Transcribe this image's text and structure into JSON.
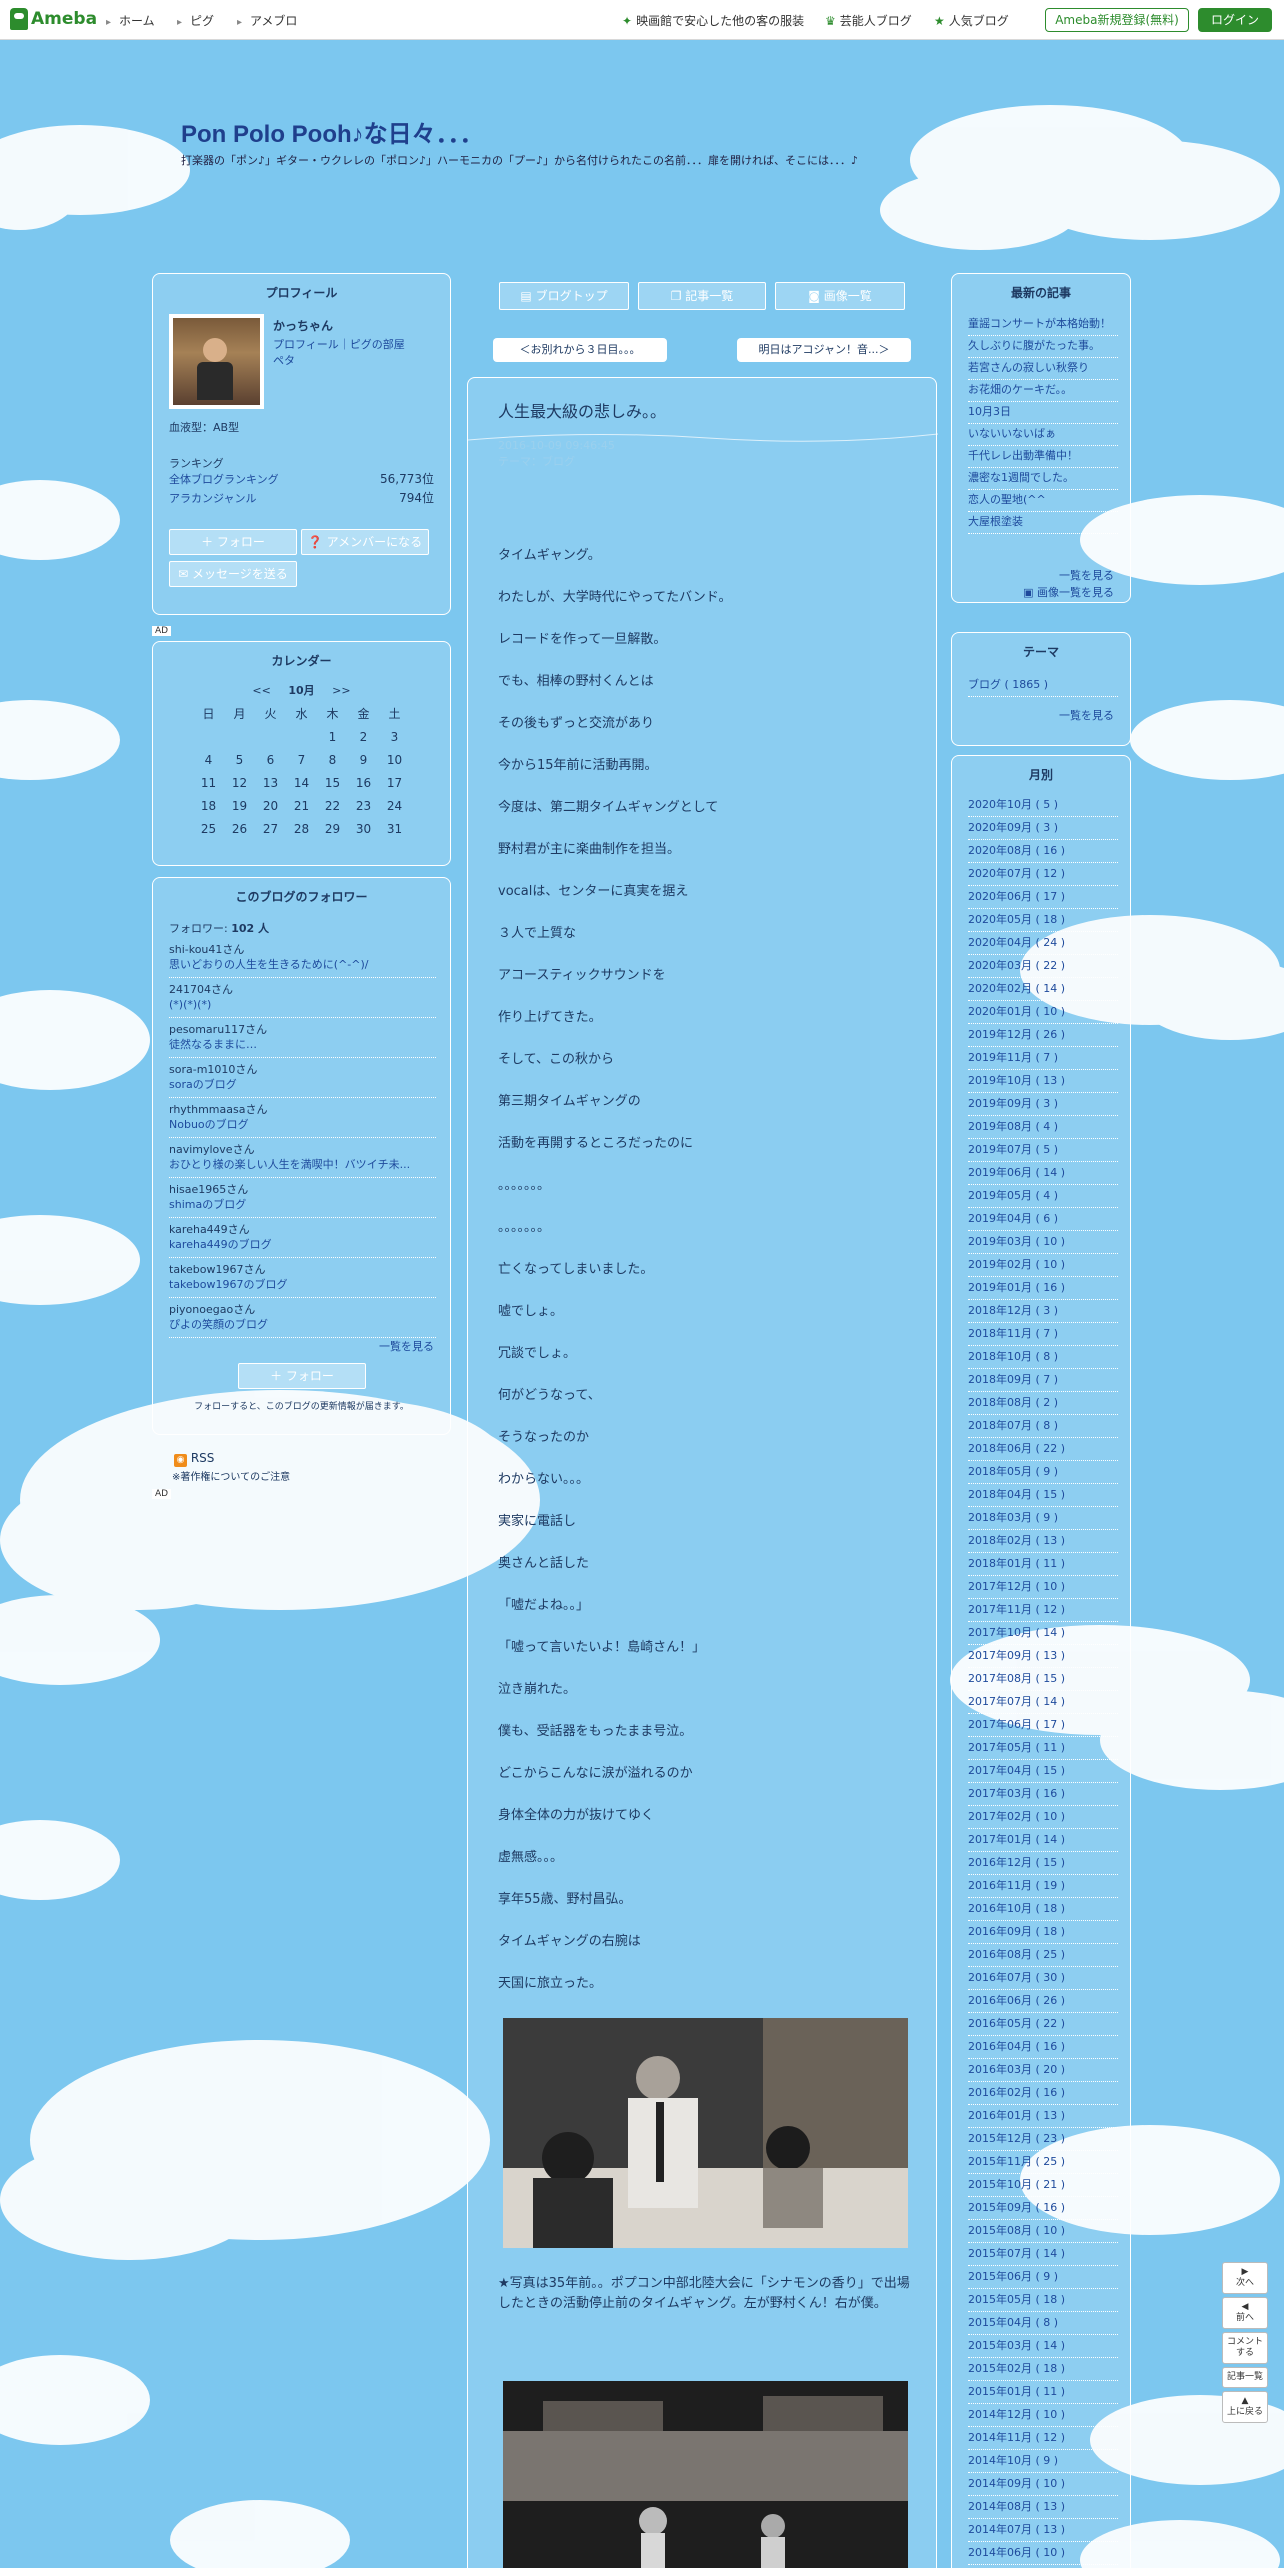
{
  "topbar": {
    "logo": "Ameba",
    "nav": [
      "ホーム",
      "ピグ",
      "アメブロ"
    ],
    "links": [
      "映画館で安心した他の客の服装",
      "芸能人ブログ",
      "人気ブログ"
    ],
    "register": "Ameba新規登録(無料)",
    "login": "ログイン"
  },
  "blog": {
    "title": "Pon Polo Pooh♪な日々．．．",
    "description": "打楽器の「ポン♪」ギター・ウクレレの「ポロン♪」ハーモニカの「プー♪」から名付けられたこの名前．．．扉を開ければ、そこには．．．♪"
  },
  "profile": {
    "heading": "プロフィール",
    "name": "かっちゃん",
    "links": "プロフィール｜ピグの部屋",
    "pet": "ペタ",
    "blood": "血液型：AB型",
    "ranking_heading": "ランキング",
    "rank1_label": "全体ブログランキング",
    "rank1_value": "56,773位",
    "rank2_label": "アラカンジャンル",
    "rank2_value": "794位",
    "follow": "フォロー",
    "member": "アメンバーになる",
    "message": "メッセージを送る"
  },
  "ad": "AD",
  "calendar": {
    "heading": "カレンダー",
    "prev": "<<",
    "month": "10月",
    "next": ">>",
    "weekdays": [
      "日",
      "月",
      "火",
      "水",
      "木",
      "金",
      "土"
    ],
    "weeks": [
      [
        "",
        "",
        "",
        "",
        "1",
        "2",
        "3"
      ],
      [
        "4",
        "5",
        "6",
        "7",
        "8",
        "9",
        "10"
      ],
      [
        "11",
        "12",
        "13",
        "14",
        "15",
        "16",
        "17"
      ],
      [
        "18",
        "19",
        "20",
        "21",
        "22",
        "23",
        "24"
      ],
      [
        "25",
        "26",
        "27",
        "28",
        "29",
        "30",
        "31"
      ]
    ]
  },
  "followers": {
    "heading": "このブログのフォロワー",
    "count_label": "フォロワー: ",
    "count": "102 人",
    "items": [
      [
        "shi-kou41さん",
        "思いどおりの人生を生きるために(^-^)/"
      ],
      [
        "241704さん",
        "(*)(*)(*)"
      ],
      [
        "pesomaru117さん",
        "徒然なるままに…"
      ],
      [
        "sora-m1010さん",
        "soraのブログ"
      ],
      [
        "rhythmmaasaさん",
        "Nobuoのブログ"
      ],
      [
        "navimyloveさん",
        "おひとり様の楽しい人生を満喫中！バツイチ未..."
      ],
      [
        "hisae1965さん",
        "shimaのブログ"
      ],
      [
        "kareha449さん",
        "kareha449のブログ"
      ],
      [
        "takebow1967さん",
        "takebow1967のブログ"
      ],
      [
        "piyonoegaoさん",
        "ぴよの笑顔のブログ"
      ]
    ],
    "more": "一覧を見る",
    "follow": "フォロー",
    "note": "フォローすると、このブログの更新情報が届きます。"
  },
  "rss": {
    "label": "RSS",
    "note": "※著作権についてのご注意"
  },
  "tabs": [
    "ブログトップ",
    "記事一覧",
    "画像一覧"
  ],
  "prev_post": "＜お別れから３日目。。。",
  "next_post": "明日はアコジャン！音...＞",
  "article": {
    "title": "人生最大級の悲しみ。。",
    "date": "2016-10-09 09:46:45",
    "theme": "テーマ：ブログ",
    "lines": [
      "タイムギャング。",
      "わたしが、大学時代にやってたバンド。",
      "レコードを作って一旦解散。",
      "でも、相棒の野村くんとは",
      "その後もずっと交流があり",
      "今から15年前に活動再開。",
      "今度は、第二期タイムギャングとして",
      "野村君が主に楽曲制作を担当。",
      "vocalは、センターに真実を据え",
      "３人で上質な",
      "アコースティックサウンドを",
      "作り上げてきた。",
      "そして、この秋から",
      "第三期タイムギャングの",
      "活動を再開するところだったのに",
      "。。。。。。。",
      "。。。。。。。",
      "亡くなってしまいました。",
      "嘘でしょ。",
      "冗談でしょ。",
      "何がどうなって、",
      "そうなったのか",
      "わからない。。。",
      "実家に電話し",
      "奥さんと話した",
      "「嘘だよね。。」",
      "「嘘って言いたいよ！島崎さん！」",
      "泣き崩れた。",
      "僕も、受話器をもったまま号泣。",
      "どこからこんなに涙が溢れるのか",
      "身体全体の力が抜けてゆく",
      "虚無感。。。",
      "享年55歳、野村昌弘。",
      "タイムギャングの右腕は",
      "天国に旅立った。"
    ],
    "caption": "★写真は35年前。。ポプコン中部北陸大会に「シナモンの香り」で出場したときの活動停止前のタイムギャング。左が野村くん！右が僕。"
  },
  "recent": {
    "heading": "最新の記事",
    "items": [
      "童謡コンサートが本格始動！",
      "久しぶりに腹がたった事。",
      "若宮さんの寂しい秋祭り",
      "お花畑のケーキだ。。",
      "10月3日",
      "いないいないばぁ",
      "千代レレ出動準備中！",
      "濃密な1週間でした。",
      "恋人の聖地(^^",
      "大屋根塗装"
    ],
    "more": "一覧を見る",
    "images": "画像一覧を見る"
  },
  "themes": {
    "heading": "テーマ",
    "items": [
      "ブログ ( 1865 )"
    ],
    "more": "一覧を見る"
  },
  "monthly": {
    "heading": "月別",
    "items": [
      "2020年10月 ( 5 )",
      "2020年09月 ( 3 )",
      "2020年08月 ( 16 )",
      "2020年07月 ( 12 )",
      "2020年06月 ( 17 )",
      "2020年05月 ( 18 )",
      "2020年04月 ( 24 )",
      "2020年03月 ( 22 )",
      "2020年02月 ( 14 )",
      "2020年01月 ( 10 )",
      "2019年12月 ( 26 )",
      "2019年11月 ( 7 )",
      "2019年10月 ( 13 )",
      "2019年09月 ( 3 )",
      "2019年08月 ( 4 )",
      "2019年07月 ( 5 )",
      "2019年06月 ( 14 )",
      "2019年05月 ( 4 )",
      "2019年04月 ( 6 )",
      "2019年03月 ( 10 )",
      "2019年02月 ( 10 )",
      "2019年01月 ( 16 )",
      "2018年12月 ( 3 )",
      "2018年11月 ( 7 )",
      "2018年10月 ( 8 )",
      "2018年09月 ( 7 )",
      "2018年08月 ( 2 )",
      "2018年07月 ( 8 )",
      "2018年06月 ( 22 )",
      "2018年05月 ( 9 )",
      "2018年04月 ( 15 )",
      "2018年03月 ( 9 )",
      "2018年02月 ( 13 )",
      "2018年01月 ( 11 )",
      "2017年12月 ( 10 )",
      "2017年11月 ( 12 )",
      "2017年10月 ( 14 )",
      "2017年09月 ( 13 )",
      "2017年08月 ( 15 )",
      "2017年07月 ( 14 )",
      "2017年06月 ( 17 )",
      "2017年05月 ( 11 )",
      "2017年04月 ( 15 )",
      "2017年03月 ( 16 )",
      "2017年02月 ( 10 )",
      "2017年01月 ( 14 )",
      "2016年12月 ( 15 )",
      "2016年11月 ( 19 )",
      "2016年10月 ( 18 )",
      "2016年09月 ( 18 )",
      "2016年08月 ( 25 )",
      "2016年07月 ( 30 )",
      "2016年06月 ( 26 )",
      "2016年05月 ( 22 )",
      "2016年04月 ( 16 )",
      "2016年03月 ( 20 )",
      "2016年02月 ( 16 )",
      "2016年01月 ( 13 )",
      "2015年12月 ( 23 )",
      "2015年11月 ( 25 )",
      "2015年10月 ( 21 )",
      "2015年09月 ( 16 )",
      "2015年08月 ( 10 )",
      "2015年07月 ( 14 )",
      "2015年06月 ( 9 )",
      "2015年05月 ( 18 )",
      "2015年04月 ( 8 )",
      "2015年03月 ( 14 )",
      "2015年02月 ( 18 )",
      "2015年01月 ( 11 )",
      "2014年12月 ( 10 )",
      "2014年11月 ( 12 )",
      "2014年10月 ( 9 )",
      "2014年09月 ( 10 )",
      "2014年08月 ( 13 )",
      "2014年07月 ( 13 )",
      "2014年06月 ( 10 )"
    ]
  },
  "sidebuttons": [
    "次へ",
    "前へ",
    "コメントする",
    "記事一覧",
    "上に戻る"
  ]
}
